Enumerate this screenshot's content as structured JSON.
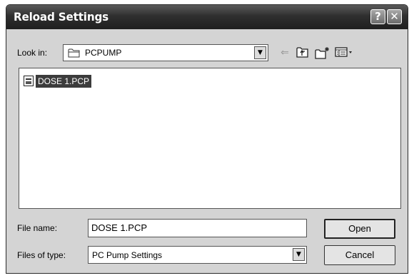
{
  "window": {
    "title": "Reload Settings",
    "help_label": "?",
    "close_label": "✕"
  },
  "toolbar": {
    "look_in_label": "Look in:",
    "look_in_value": "PCPUMP",
    "back_icon": "back-arrow-icon",
    "up_icon": "up-one-level-icon",
    "new_folder_icon": "new-folder-icon",
    "views_icon": "views-menu-icon"
  },
  "files": [
    {
      "name": "DOSE 1.PCP",
      "icon": "pcp-file-icon",
      "selected": true
    }
  ],
  "form": {
    "file_name_label": "File name:",
    "file_name_value": "DOSE 1.PCP",
    "file_type_label": "Files of type:",
    "file_type_value": "PC Pump Settings"
  },
  "buttons": {
    "open": "Open",
    "cancel": "Cancel"
  }
}
